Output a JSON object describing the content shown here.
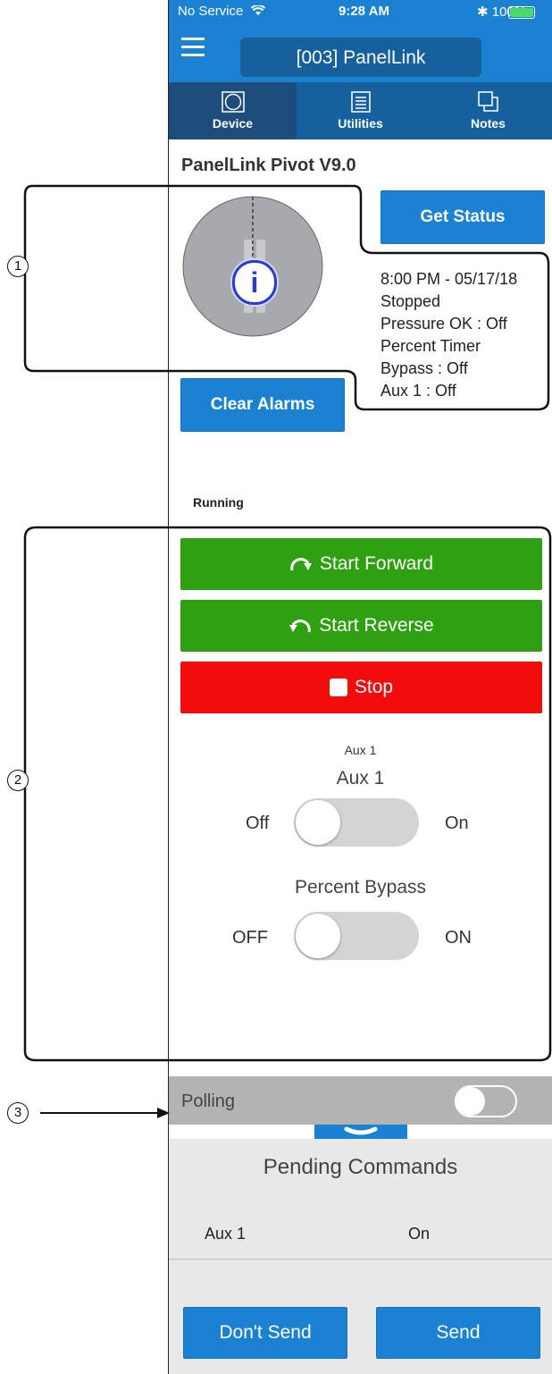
{
  "status_bar": {
    "carrier": "No Service",
    "time": "9:28 AM",
    "battery": "100%"
  },
  "header": {
    "title": "[003] PanelLink"
  },
  "tabs": [
    {
      "label": "Device",
      "icon": "circle-in-square-icon",
      "active": true
    },
    {
      "label": "Utilities",
      "icon": "list-icon",
      "active": false
    },
    {
      "label": "Notes",
      "icon": "notes-icon",
      "active": false
    }
  ],
  "device": {
    "name": "PanelLink Pivot V9.0",
    "get_status_label": "Get Status",
    "clear_alarms_label": "Clear Alarms",
    "info_icon_text": "i",
    "status_lines": [
      "8:00 PM - 05/17/18",
      "Stopped",
      "Pressure OK : Off",
      "Percent Timer",
      "Bypass : Off",
      "Aux 1 : Off"
    ]
  },
  "controls": {
    "running_label": "Running",
    "start_forward_label": "Start Forward",
    "start_reverse_label": "Start Reverse",
    "stop_label": "Stop",
    "aux1_small_label": "Aux 1",
    "aux1_label": "Aux 1",
    "aux1_off": "Off",
    "aux1_on": "On",
    "aux1_state": "off",
    "bypass_label": "Percent Bypass",
    "bypass_off": "OFF",
    "bypass_on": "ON",
    "bypass_state": "off"
  },
  "polling": {
    "label": "Polling",
    "state": "off"
  },
  "pending": {
    "title": "Pending Commands",
    "rows": [
      {
        "name": "Aux 1",
        "value": "On"
      }
    ],
    "dont_send_label": "Don't Send",
    "send_label": "Send"
  },
  "callouts": [
    "1",
    "2",
    "3"
  ],
  "colors": {
    "header_blue": "#1b82d2",
    "tab_bar": "#16609e",
    "active_tab": "#1d4d7b",
    "start_green": "#2ea012",
    "stop_red": "#f30c0c",
    "pivot_gray": "#a7a9ac",
    "polling_gray": "#b3b3b3"
  }
}
